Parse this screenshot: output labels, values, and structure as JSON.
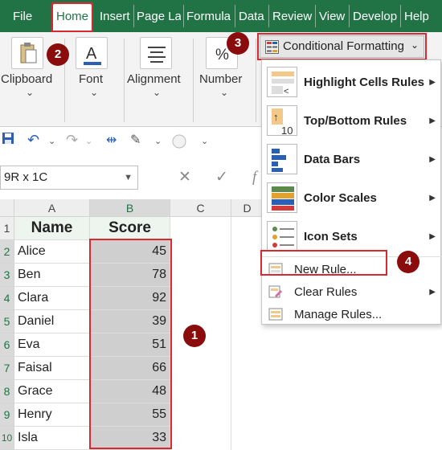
{
  "tabs": [
    "File",
    "Home",
    "Insert",
    "Page Lay",
    "Formula",
    "Data",
    "Review",
    "View",
    "Develop",
    "Help"
  ],
  "ribbon": {
    "clipboard": "Clipboard",
    "font": "Font",
    "alignment": "Alignment",
    "number": "Number",
    "conditional_formatting": "Conditional Formatting"
  },
  "name_box": "9R x 1C",
  "formula_bar": {
    "fx": "f"
  },
  "columns": [
    "A",
    "B",
    "C",
    "D"
  ],
  "rows": [
    "1",
    "2",
    "3",
    "4",
    "5",
    "6",
    "7",
    "8",
    "9",
    "10"
  ],
  "table": {
    "headers": [
      "Name",
      "Score"
    ],
    "data": [
      {
        "name": "Alice",
        "score": "45"
      },
      {
        "name": "Ben",
        "score": "78"
      },
      {
        "name": "Clara",
        "score": "92"
      },
      {
        "name": "Daniel",
        "score": "39"
      },
      {
        "name": "Eva",
        "score": "51"
      },
      {
        "name": "Faisal",
        "score": "66"
      },
      {
        "name": "Grace",
        "score": "48"
      },
      {
        "name": "Henry",
        "score": "55"
      },
      {
        "name": "Isla",
        "score": "33"
      }
    ]
  },
  "menu": {
    "highlight": "Highlight Cells Rules",
    "topbottom": "Top/Bottom Rules",
    "databars": "Data Bars",
    "colorscales": "Color Scales",
    "iconsets": "Icon Sets",
    "newrule": "New Rule...",
    "clear": "Clear Rules",
    "manage": "Manage Rules...",
    "topbottom_icon_text": "10"
  },
  "badges": [
    "1",
    "2",
    "3",
    "4"
  ],
  "colors": {
    "excel_green": "#217346",
    "highlight_red": "#d9282f",
    "badge": "#8b0c0c"
  }
}
